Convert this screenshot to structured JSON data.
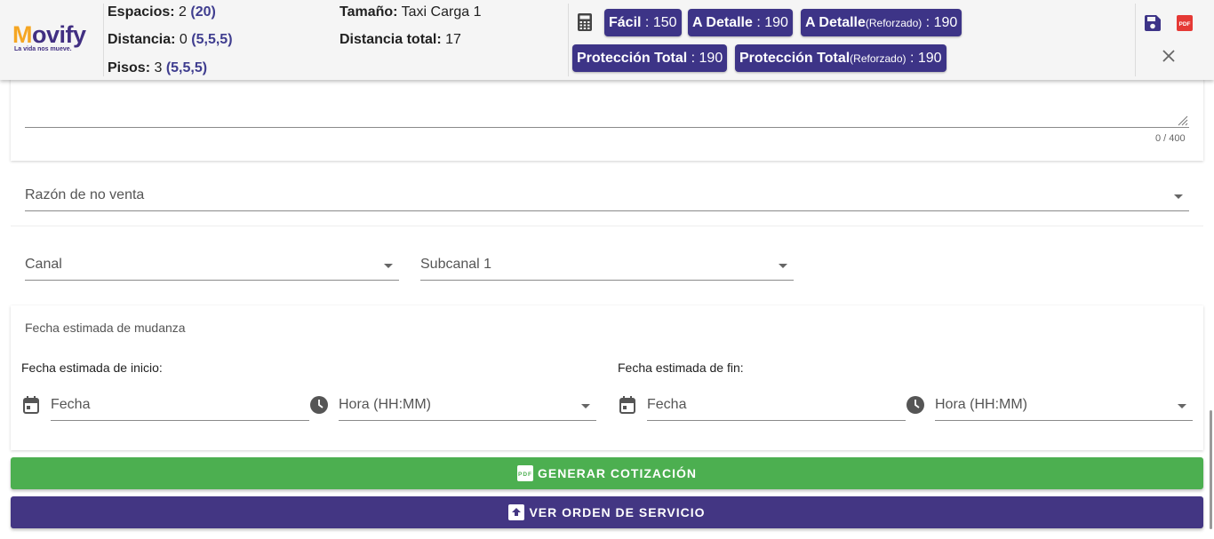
{
  "brand": {
    "name": "Movify",
    "tagline": "La vida nos mueve."
  },
  "summary": {
    "espacios_label": "Espacios:",
    "espacios_value": "2",
    "espacios_extra": "(20)",
    "distancia_label": "Distancia:",
    "distancia_value": "0",
    "distancia_extra": "(5,5,5)",
    "pisos_label": "Pisos:",
    "pisos_value": "3",
    "pisos_extra": "(5,5,5)",
    "tamano_label": "Tamaño:",
    "tamano_value": "Taxi Carga 1",
    "distancia_total_label": "Distancia total:",
    "distancia_total_value": "17"
  },
  "badges": [
    {
      "name": "Fácil",
      "suffix": "",
      "value": "150"
    },
    {
      "name": "A Detalle",
      "suffix": "",
      "value": "190"
    },
    {
      "name": "A Detalle",
      "suffix": "(Reforzado)",
      "value": "190"
    },
    {
      "name": "Protección Total",
      "suffix": "",
      "value": "190"
    },
    {
      "name": "Protección Total",
      "suffix": "(Reforzado)",
      "value": "190"
    }
  ],
  "badge_sep": " : ",
  "comment": {
    "counter": "0 / 400"
  },
  "razon": {
    "placeholder": "Razón de no venta"
  },
  "canal": {
    "placeholder": "Canal"
  },
  "subcanal": {
    "placeholder": "Subcanal 1"
  },
  "fecha_section": {
    "title": "Fecha estimada de mudanza",
    "inicio_label": "Fecha estimada de inicio:",
    "fin_label": "Fecha estimada de fin:",
    "fecha_placeholder": "Fecha",
    "hora_placeholder": "Hora (HH:MM)"
  },
  "actions": {
    "generar": "GENERAR COTIZACIÓN",
    "ver_orden": "VER ORDEN DE SERVICIO"
  },
  "colors": {
    "brand": "#412f82",
    "badge": "#3d3487",
    "green": "#4caf50",
    "purple": "#433683",
    "pdf_red": "#e53935"
  }
}
